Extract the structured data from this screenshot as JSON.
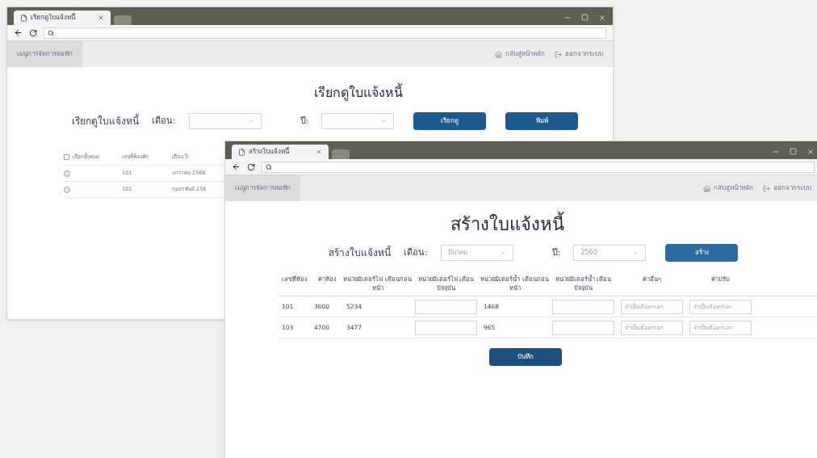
{
  "back_window": {
    "tab_title": "เรียกดูใบแจ้งหนี้",
    "menu": "เมนูการจัดการหอพัก",
    "nav_links": [
      "กลับสู่หน้าหลัก",
      "ออกจากระบบ"
    ],
    "heading": "เรียกดูใบแจ้งหนี้",
    "form_label": "เรียกดูใบแจ้งหนี้",
    "month_label": "เดือน:",
    "year_label": "ปี:",
    "buttons": [
      "เรียกดู",
      "พิมพ์"
    ],
    "table": {
      "columns": [
        "เลือกทั้งหมด",
        "เลขที่ห้องพัก",
        "เดือน ปี"
      ],
      "select_all_checked": false,
      "rows": [
        {
          "checked": false,
          "room": "101",
          "period": "มกราคม 2560"
        },
        {
          "checked": false,
          "room": "101",
          "period": "กุมภาพันธ์ 256"
        }
      ]
    }
  },
  "front_window": {
    "tab_title": "สร้างใบแจ้งหนี้",
    "menu": "เมนูการจัดการหอพัก",
    "nav_links": [
      "กลับสู่หน้าหลัก",
      "ออกจากระบบ"
    ],
    "heading": "สร้างใบแจ้งหนี้",
    "form_label": "สร้างใบแจ้งหนี้",
    "month_label": "เดือน:",
    "month_value": "มีนาคม",
    "year_label": "ปี:",
    "year_value": "2560",
    "create_button": "สร้าง",
    "table": {
      "columns": [
        "เลขที่ห้อง",
        "ค่าห้อง",
        "หน่วยมิเตอร์ไฟ เดือนก่อนหน้า",
        "หน่วยมิเตอร์ไฟ เดือนปัจจุบัน",
        "หน่วยมิเตอร์น้ำ เดือนก่อนหน้า",
        "หน่วยมิเตอร์น้ำ เดือนปัจจุบัน",
        "ค่าอื่นๆ",
        "ค่าปรับ"
      ],
      "rows": [
        {
          "room": "101",
          "rent": "3600",
          "elec_prev": "5234",
          "water_prev": "1468",
          "other_placeholder": "จำเป็นต้องกรอก",
          "fine_placeholder": "จำเป็นต้องกรอก"
        },
        {
          "room": "103",
          "rent": "4700",
          "elec_prev": "3477",
          "water_prev": "965",
          "other_placeholder": "จำเป็นต้องกรอก",
          "fine_placeholder": "จำเป็นต้องกรอก"
        }
      ]
    },
    "save_button": "บันทึก"
  }
}
